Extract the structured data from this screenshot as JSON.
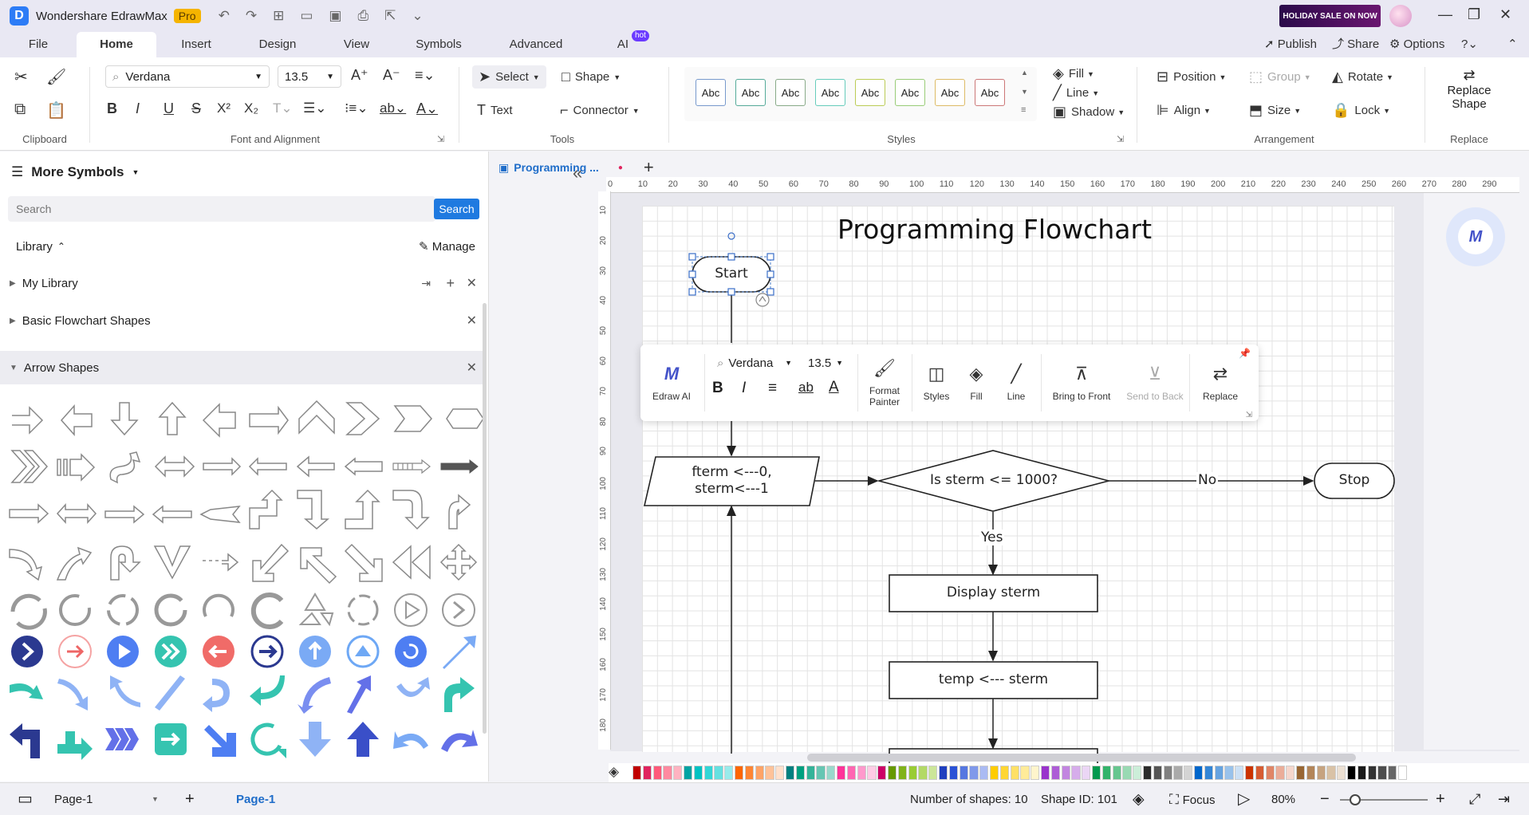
{
  "title_bar": {
    "app_name": "Wondershare EdrawMax",
    "badge": "Pro",
    "sale_banner": "HOLIDAY SALE ON NOW"
  },
  "menu": {
    "tabs": [
      "File",
      "Home",
      "Insert",
      "Design",
      "View",
      "Symbols",
      "Advanced",
      "AI"
    ],
    "active_tab": "Home",
    "ai_badge": "hot",
    "publish": "Publish",
    "share": "Share",
    "options": "Options"
  },
  "ribbon": {
    "clipboard_label": "Clipboard",
    "font_name": "Verdana",
    "font_size": "13.5",
    "font_group_label": "Font and Alignment",
    "select": "Select",
    "shape": "Shape",
    "text": "Text",
    "connector": "Connector",
    "tools_label": "Tools",
    "style_sample": "Abc",
    "styles_label": "Styles",
    "fill": "Fill",
    "line": "Line",
    "shadow": "Shadow",
    "position": "Position",
    "group": "Group",
    "rotate": "Rotate",
    "align": "Align",
    "size": "Size",
    "lock": "Lock",
    "arrangement_label": "Arrangement",
    "replace_shape_1": "Replace",
    "replace_shape_2": "Shape",
    "replace_label": "Replace"
  },
  "sidebar": {
    "header": "More Symbols",
    "search_placeholder": "Search",
    "search_button": "Search",
    "library_label": "Library",
    "manage": "Manage",
    "items": [
      {
        "label": "My Library"
      },
      {
        "label": "Basic Flowchart Shapes"
      },
      {
        "label": "Arrow Shapes"
      }
    ]
  },
  "document": {
    "tab_title": "Programming ...",
    "ruler_h": [
      "0",
      "10",
      "20",
      "30",
      "40",
      "50",
      "60",
      "70",
      "80",
      "90",
      "100",
      "110",
      "120",
      "130",
      "140",
      "150",
      "160",
      "170",
      "180",
      "190",
      "200",
      "210",
      "220",
      "230",
      "240",
      "250",
      "260",
      "270",
      "280",
      "290"
    ],
    "ruler_v": [
      "10",
      "20",
      "30",
      "40",
      "50",
      "60",
      "70",
      "80",
      "90",
      "100",
      "110",
      "120",
      "130",
      "140",
      "150",
      "160",
      "170",
      "180"
    ]
  },
  "flowchart": {
    "title": "Programming Flowchart",
    "start": "Start",
    "init_line1": "fterm <---0,",
    "init_line2": "sterm<---1",
    "decision": "Is sterm <= 1000?",
    "no_label": "No",
    "stop": "Stop",
    "yes_label": "Yes",
    "display": "Display sterm",
    "temp": "temp <--- sterm"
  },
  "floating_toolbar": {
    "edraw_ai": "Edraw AI",
    "font_name": "Verdana",
    "font_size": "13.5",
    "format_painter_1": "Format",
    "format_painter_2": "Painter",
    "styles": "Styles",
    "fill": "Fill",
    "line": "Line",
    "bring_to_front": "Bring to Front",
    "send_to_back": "Send to Back",
    "replace": "Replace"
  },
  "status_bar": {
    "page_select": "Page-1",
    "page_tab": "Page-1",
    "num_shapes": "Number of shapes: 10",
    "shape_id": "Shape ID: 101",
    "focus": "Focus",
    "zoom": "80%"
  },
  "colors": {
    "accent": "#1f7ae0",
    "palette": [
      "#c00000",
      "#e0245e",
      "#ff5a7a",
      "#ff8aa0",
      "#ffb3c1",
      "#00a3a3",
      "#00c2c2",
      "#33d6d6",
      "#66e0e0",
      "#99ebeb",
      "#ff6600",
      "#ff8533",
      "#ffa366",
      "#ffc299",
      "#ffe0cc",
      "#008080",
      "#00a080",
      "#33b399",
      "#66c6b3",
      "#99d9cc",
      "#ff3399",
      "#ff66b2",
      "#ff99cc",
      "#ffcce5",
      "#cc0066",
      "#669900",
      "#80b31a",
      "#99cc33",
      "#b3d966",
      "#cce699",
      "#1f3fbf",
      "#2a52d6",
      "#5577e0",
      "#8099ea",
      "#aabbf3",
      "#ffcc00",
      "#ffd633",
      "#ffe066",
      "#ffeb99",
      "#fff5cc",
      "#9933cc",
      "#ad5cd6",
      "#c285e0",
      "#d6adeb",
      "#ebd6f5",
      "#00994d",
      "#33b36b",
      "#66c68f",
      "#99d9b3",
      "#cceed9",
      "#2b2b2b",
      "#555555",
      "#808080",
      "#aaaaaa",
      "#d4d4d4",
      "#0066cc",
      "#3385d6",
      "#66a3e0",
      "#99c2eb",
      "#cce0f5",
      "#cc3300",
      "#d65c33",
      "#e08566",
      "#ebad99",
      "#f5d6cc",
      "#996633",
      "#b38559",
      "#c6a380",
      "#d9c2a6",
      "#ece0d3",
      "#000000",
      "#1a1a1a",
      "#333333",
      "#4d4d4d",
      "#666666",
      "#ffffff"
    ]
  }
}
